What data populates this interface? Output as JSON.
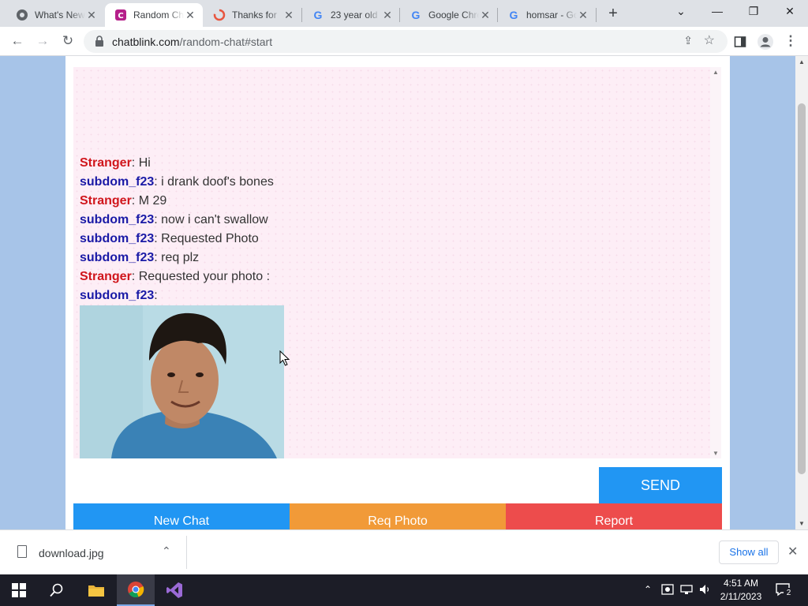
{
  "browser": {
    "tabs": [
      {
        "title": "What's New",
        "favicon": "chrome-icon",
        "active": false
      },
      {
        "title": "Random Chat",
        "favicon": "chatblink-icon",
        "active": true
      },
      {
        "title": "Thanks for",
        "favicon": "spinner-icon",
        "active": false
      },
      {
        "title": "23 year old",
        "favicon": "google-icon",
        "active": false
      },
      {
        "title": "Google Chrome",
        "favicon": "google-icon",
        "active": false
      },
      {
        "title": "homsar - Google",
        "favicon": "google-icon",
        "active": false
      }
    ],
    "new_tab_label": "+",
    "url_host": "chatblink.com",
    "url_path": "/random-chat#start"
  },
  "chat": {
    "messages": [
      {
        "sender": "Stranger",
        "role": "stranger",
        "text": ": Hi"
      },
      {
        "sender": "subdom_f23",
        "role": "me",
        "text": ": i drank doof's bones"
      },
      {
        "sender": "Stranger",
        "role": "stranger",
        "text": ": M 29"
      },
      {
        "sender": "subdom_f23",
        "role": "me",
        "text": ": now i can't swallow"
      },
      {
        "sender": "subdom_f23",
        "role": "me",
        "text": ": Requested Photo"
      },
      {
        "sender": "subdom_f23",
        "role": "me",
        "text": ": req plz"
      },
      {
        "sender": "Stranger",
        "role": "stranger",
        "text": ": Requested your photo :"
      },
      {
        "sender": "subdom_f23",
        "role": "me",
        "text": ":"
      }
    ],
    "photo": "portrait-photo",
    "input_value": "",
    "send_label": "SEND",
    "actions": {
      "new_chat": "New Chat",
      "req_photo": "Req Photo",
      "report": "Report"
    },
    "colors": {
      "stranger": "#d0161c",
      "me": "#1a1aa6",
      "send": "#2196f3",
      "new_chat": "#2196f3",
      "req_photo": "#f19a38",
      "report": "#ed4c4c"
    }
  },
  "downloads": {
    "file_name": "download.jpg",
    "show_all_label": "Show all"
  },
  "taskbar": {
    "apps": [
      "windows-start-icon",
      "search-icon",
      "file-explorer-icon",
      "chrome-icon",
      "visual-studio-icon"
    ],
    "time": "4:51 AM",
    "date": "2/11/2023",
    "notification_count": "2"
  }
}
